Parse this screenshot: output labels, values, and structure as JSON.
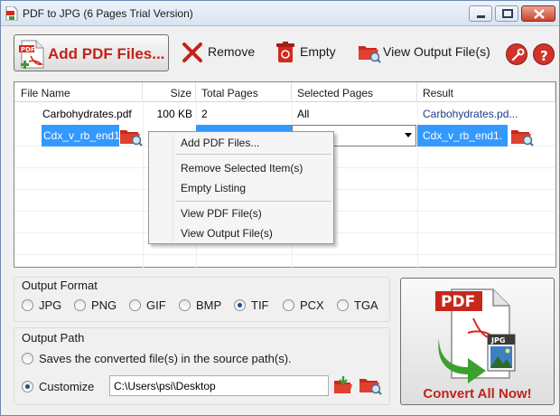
{
  "window": {
    "title": "PDF to JPG (6 Pages Trial Version)"
  },
  "toolbar": {
    "add_label": "Add PDF Files...",
    "remove_label": "Remove",
    "empty_label": "Empty",
    "view_output_label": "View Output File(s)"
  },
  "grid": {
    "columns": [
      "File Name",
      "Size",
      "Total Pages",
      "Selected Pages",
      "Result"
    ],
    "rows": [
      {
        "file_name": "Carbohydrates.pdf",
        "size": "100 KB",
        "total_pages": "2",
        "selected_pages": "All",
        "result": "Carbohydrates.pd..."
      },
      {
        "file_name": "Cdx_v_rb_end1",
        "size": "",
        "total_pages": "",
        "selected_pages": "",
        "result": "Cdx_v_rb_end1."
      }
    ]
  },
  "context_menu": {
    "items": [
      "Add PDF Files...",
      "Remove Selected Item(s)",
      "Empty Listing",
      "View PDF File(s)",
      "View Output File(s)"
    ]
  },
  "output_format": {
    "title": "Output Format",
    "options": [
      "JPG",
      "PNG",
      "GIF",
      "BMP",
      "TIF",
      "PCX",
      "TGA"
    ],
    "selected": "TIF"
  },
  "output_path": {
    "title": "Output Path",
    "source_label": "Saves the converted file(s) in the source path(s).",
    "customize_label": "Customize",
    "selected": "Customize",
    "path_value": "C:\\Users\\psi\\Desktop"
  },
  "convert": {
    "label": "Convert All Now!",
    "icon_pdf_text": "PDF",
    "icon_jpg_text": "JPG"
  },
  "colors": {
    "accent_red": "#c0231a",
    "selection_blue": "#3399ff",
    "link_blue": "#1a3d8f"
  }
}
